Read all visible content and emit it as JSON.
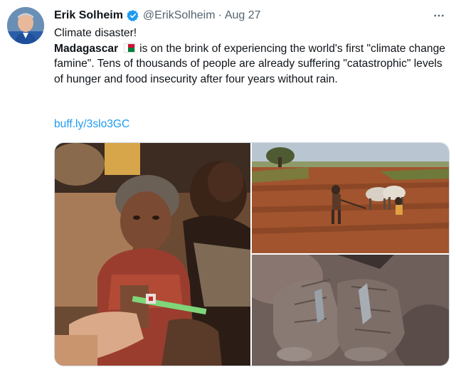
{
  "tweet": {
    "author_name": "Erik Solheim",
    "handle": "@ErikSolheim",
    "separator": "·",
    "date": "Aug 27",
    "more_icon": "more-horizontal-icon",
    "verified_icon": "verified-badge-icon",
    "line1": "Climate disaster!",
    "bold_word": "Madagascar",
    "flag_icon": "madagascar-flag-icon",
    "body_text": "is on the brink of experiencing the world's first \"climate change famine\".  Tens of thousands of people are already suffering \"catastrophic\" levels of hunger and food insecurity after four years without rain.",
    "link": "buff.ly/3slo3GC",
    "media": [
      {
        "name": "photo-child-wristband"
      },
      {
        "name": "photo-ploughing-field"
      },
      {
        "name": "photo-hands-holding-food"
      }
    ]
  },
  "colors": {
    "link": "#1d9bf0",
    "secondary_text": "#536471",
    "verified": "#1d9bf0"
  }
}
